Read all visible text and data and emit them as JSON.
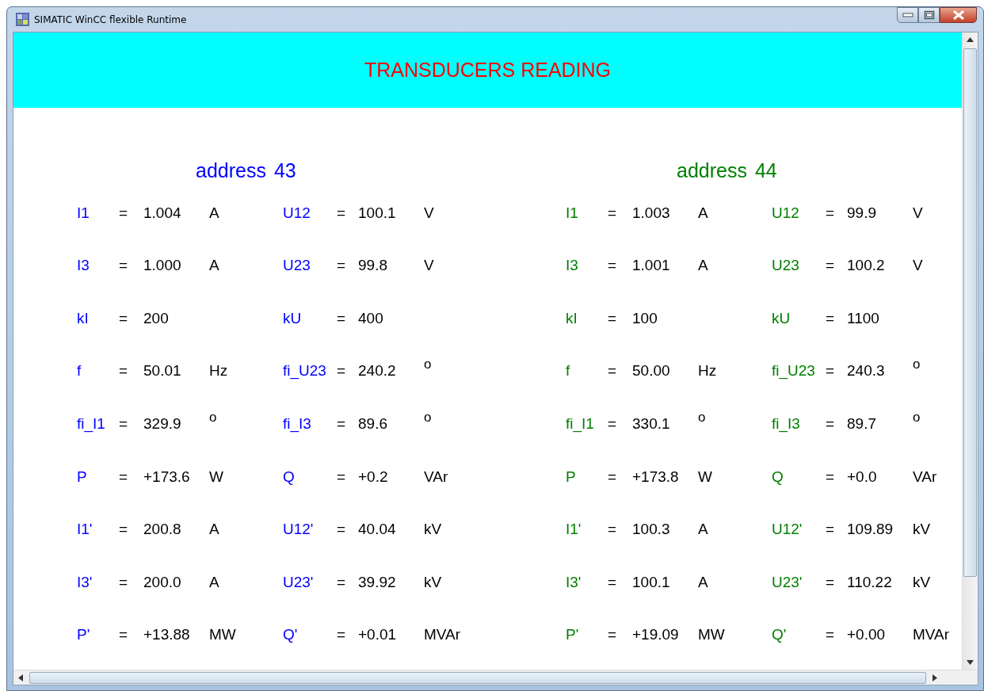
{
  "window": {
    "title": "SIMATIC WinCC flexible Runtime"
  },
  "header": {
    "title": "TRANSDUCERS READING"
  },
  "groups": [
    {
      "label": "address",
      "number": "43",
      "color": "#0000ff",
      "readings": [
        {
          "name": "I1",
          "equals": "=",
          "value": "1.004",
          "unit": "A"
        },
        {
          "name": "U12",
          "equals": "=",
          "value": "100.1",
          "unit": "V"
        },
        {
          "name": "I3",
          "equals": "=",
          "value": "1.000",
          "unit": "A"
        },
        {
          "name": "U23",
          "equals": "=",
          "value": "99.8",
          "unit": "V"
        },
        {
          "name": "kI",
          "equals": "=",
          "value": "200"
        },
        {
          "name": "kU",
          "equals": "=",
          "value": "400"
        },
        {
          "name": "f",
          "equals": "=",
          "value": "50.01",
          "unit": "Hz"
        },
        {
          "name": "fi_U23",
          "equals": "=",
          "value": "240.2",
          "unit": "$^{o}$"
        },
        {
          "name": "fi_I1",
          "equals": "=",
          "value": "329.9",
          "unit": "$^{o}$"
        },
        {
          "name": "fi_I3",
          "equals": "=",
          "value": "89.6",
          "unit": "$^{o}$"
        },
        {
          "name": "P",
          "equals": "=",
          "value": "+173.6",
          "unit": "W"
        },
        {
          "name": "Q",
          "equals": "=",
          "value": "+0.2",
          "unit": "VAr"
        },
        {
          "name": "I1'",
          "equals": "=",
          "value": "200.8",
          "unit": "A"
        },
        {
          "name": "U12'",
          "equals": "=",
          "value": "40.04",
          "unit": "kV"
        },
        {
          "name": "I3'",
          "equals": "=",
          "value": "200.0",
          "unit": "A"
        },
        {
          "name": "U23'",
          "equals": "=",
          "value": "39.92",
          "unit": "kV"
        },
        {
          "name": "P'",
          "equals": "=",
          "value": "+13.88",
          "unit": "MW"
        },
        {
          "name": "Q'",
          "equals": "=",
          "value": "+0.01",
          "unit": "MVAr"
        }
      ]
    },
    {
      "label": "address",
      "number": "44",
      "color": "#008000",
      "readings": [
        {
          "name": "I1",
          "equals": "=",
          "value": "1.003",
          "unit": "A"
        },
        {
          "name": "U12",
          "equals": "=",
          "value": "99.9",
          "unit": "V"
        },
        {
          "name": "I3",
          "equals": "=",
          "value": "1.001",
          "unit": "A"
        },
        {
          "name": "U23",
          "equals": "=",
          "value": "100.2",
          "unit": "V"
        },
        {
          "name": "kI",
          "equals": "=",
          "value": "100"
        },
        {
          "name": "kU",
          "equals": "=",
          "value": "1100"
        },
        {
          "name": "f",
          "equals": "=",
          "value": "50.00",
          "unit": "Hz"
        },
        {
          "name": "fi_U23",
          "equals": "=",
          "value": "240.3",
          "unit": "$^{o}$"
        },
        {
          "name": "fi_I1",
          "equals": "=",
          "value": "330.1",
          "unit": "$^{o}$"
        },
        {
          "name": "fi_I3",
          "equals": "=",
          "value": "89.7",
          "unit": "$^{o}$"
        },
        {
          "name": "P",
          "equals": "=",
          "value": "+173.8",
          "unit": "W"
        },
        {
          "name": "Q",
          "equals": "=",
          "value": "+0.0",
          "unit": "VAr"
        },
        {
          "name": "I1'",
          "equals": "=",
          "value": "100.3",
          "unit": "A"
        },
        {
          "name": "U12'",
          "equals": "=",
          "value": "109.89",
          "unit": "kV"
        },
        {
          "name": "I3'",
          "equals": "=",
          "value": "100.1",
          "unit": "A"
        },
        {
          "name": "U23'",
          "equals": "=",
          "value": "110.22",
          "unit": "kV"
        },
        {
          "name": "P'",
          "equals": "=",
          "value": "+19.09",
          "unit": "MW"
        },
        {
          "name": "Q'",
          "equals": "=",
          "value": "+0.00",
          "unit": "MVAr"
        }
      ]
    }
  ]
}
